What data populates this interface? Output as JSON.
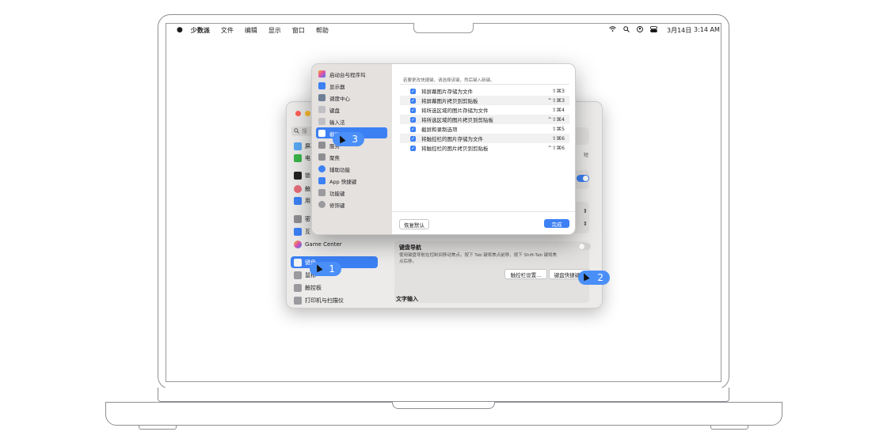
{
  "menubar": {
    "app": "少数派",
    "items": [
      "文件",
      "编辑",
      "显示",
      "窗口",
      "帮助"
    ],
    "date": "3月14日",
    "time": "3:14 AM"
  },
  "back_window": {
    "search_placeholder": "搜",
    "sidebar_items": [
      "屏幕",
      "电",
      "锁",
      "触",
      "用",
      "密",
      "互",
      "Game Center",
      "键盘",
      "鼠标",
      "触控板",
      "打印机与扫描仪"
    ],
    "right": {
      "side_label": "短",
      "kb_nav_title": "键盘导航",
      "kb_nav_desc1": "使用键盘导航在控制间移动焦点。按下 Tab 键将焦点前移，按下 Shift-Tab 键将焦",
      "kb_nav_desc2": "点后移。",
      "touchbar_button": "触控栏设置...",
      "shortcuts_button": "键盘快捷键...",
      "text_input_title": "文字输入"
    }
  },
  "dialog": {
    "sidebar": [
      "启动台与程序坞",
      "显示器",
      "调度中心",
      "键盘",
      "输入法",
      "截屏",
      "服务",
      "聚焦",
      "辅助功能",
      "App 快捷键",
      "功能键",
      "修饰键"
    ],
    "hint": "若要更改快捷键，请选择该键，然后键入新键。",
    "rows": [
      {
        "label": "将屏幕图片存储为文件",
        "shortcut": "⇧⌘3"
      },
      {
        "label": "将屏幕图片拷贝到剪贴板",
        "shortcut": "^⇧⌘3"
      },
      {
        "label": "将所选区域的图片存储为文件",
        "shortcut": "⇧⌘4"
      },
      {
        "label": "将所选区域的图片拷贝到剪贴板",
        "shortcut": "^⇧⌘4"
      },
      {
        "label": "截屏和录制选项",
        "shortcut": "⇧⌘5"
      },
      {
        "label": "将触控栏的图片存储为文件",
        "shortcut": "⇧⌘6"
      },
      {
        "label": "将触控栏的图片拷贝到剪贴板",
        "shortcut": "^⇧⌘6"
      }
    ],
    "restore_button": "恢复默认",
    "done_button": "完成"
  },
  "annotations": [
    "1",
    "2",
    "3"
  ]
}
